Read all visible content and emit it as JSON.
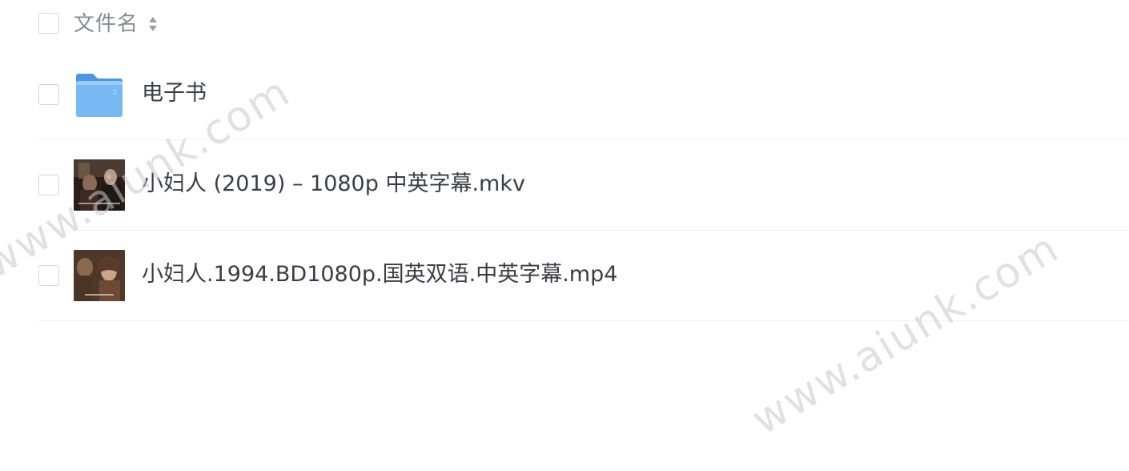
{
  "header": {
    "column_label": "文件名",
    "sort_icon": "sort-updown-icon"
  },
  "files": [
    {
      "name": "电子书",
      "type": "folder",
      "icon": "folder-icon"
    },
    {
      "name": "小妇人 (2019) – 1080p 中英字幕.mkv",
      "type": "video",
      "icon": "video-thumbnail"
    },
    {
      "name": "小妇人.1994.BD1080p.国英双语.中英字幕.mp4",
      "type": "video",
      "icon": "video-thumbnail"
    }
  ],
  "watermark": "www.aiunk.com",
  "colors": {
    "folder": "#5aa8ee",
    "divider": "#eef0f2",
    "header_text": "#888c92",
    "name_text": "#3a3d42"
  }
}
